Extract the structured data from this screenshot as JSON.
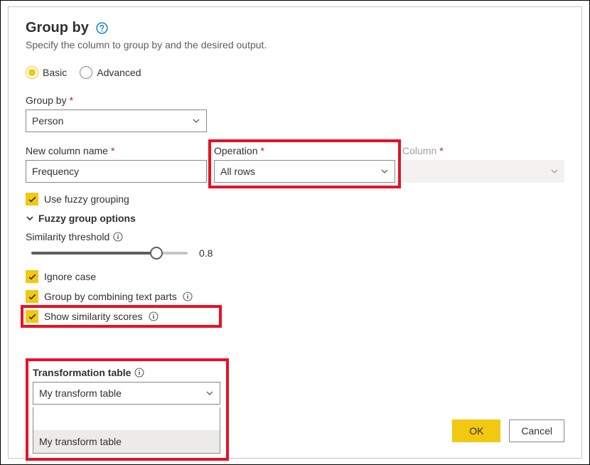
{
  "dialog": {
    "title": "Group by",
    "subtitle": "Specify the column to group by and the desired output."
  },
  "mode": {
    "basic": "Basic",
    "advanced": "Advanced"
  },
  "group_by": {
    "label": "Group by",
    "value": "Person"
  },
  "new_column": {
    "label": "New column name",
    "value": "Frequency"
  },
  "operation": {
    "label": "Operation",
    "value": "All rows"
  },
  "column": {
    "label": "Column"
  },
  "fuzzy": {
    "use_label": "Use fuzzy grouping",
    "section_label": "Fuzzy group options",
    "threshold_label": "Similarity threshold",
    "threshold_value": "0.8",
    "ignore_case": "Ignore case",
    "combine_text": "Group by combining text parts",
    "show_scores": "Show similarity scores",
    "transform_label": "Transformation table",
    "transform_value": "My transform table",
    "transform_option": "My transform table"
  },
  "footer": {
    "ok": "OK",
    "cancel": "Cancel"
  }
}
